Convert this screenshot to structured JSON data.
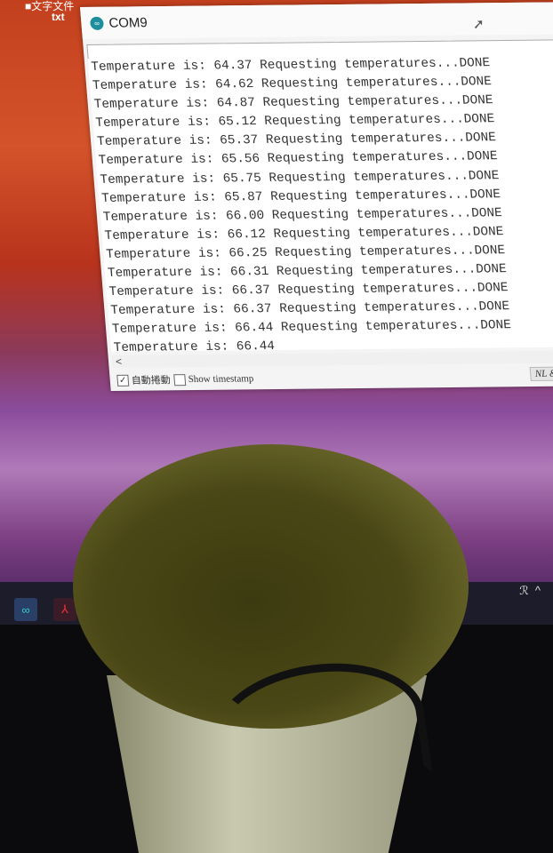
{
  "desktop": {
    "icon_label_top": "■文字文件",
    "icon_label": "txt"
  },
  "window": {
    "title": "COM9",
    "input_value": "",
    "output_lines": [
      "Temperature is: 64.37 Requesting temperatures...DONE",
      "Temperature is: 64.62 Requesting temperatures...DONE",
      "Temperature is: 64.87 Requesting temperatures...DONE",
      "Temperature is: 65.12 Requesting temperatures...DONE",
      "Temperature is: 65.37 Requesting temperatures...DONE",
      "Temperature is: 65.56 Requesting temperatures...DONE",
      "Temperature is: 65.75 Requesting temperatures...DONE",
      "Temperature is: 65.87 Requesting temperatures...DONE",
      "Temperature is: 66.00 Requesting temperatures...DONE",
      "Temperature is: 66.12 Requesting temperatures...DONE",
      "Temperature is: 66.25 Requesting temperatures...DONE",
      "Temperature is: 66.31 Requesting temperatures...DONE",
      "Temperature is: 66.37 Requesting temperatures...DONE",
      "Temperature is: 66.37 Requesting temperatures...DONE",
      "Temperature is: 66.44 Requesting temperatures...DONE",
      "Temperature is: 66.44"
    ],
    "scroll_left": "<",
    "autoscroll_label": "自動捲動",
    "autoscroll_checked": true,
    "timestamp_label": "Show timestamp",
    "timestamp_checked": false,
    "line_ending": "NL & CR"
  },
  "taskbar": {
    "apps": [
      "arduino-icon",
      "acrobat-icon"
    ],
    "tray": "^"
  }
}
